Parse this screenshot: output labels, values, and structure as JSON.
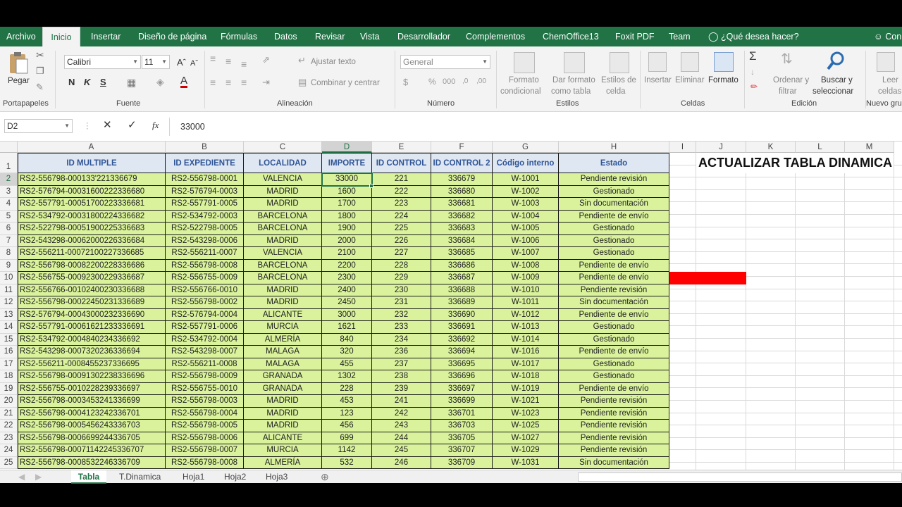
{
  "ribbon_tabs": [
    "Archivo",
    "Inicio",
    "Insertar",
    "Diseño de página",
    "Fórmulas",
    "Datos",
    "Revisar",
    "Vista",
    "Desarrollador",
    "Complementos",
    "ChemOffice13",
    "Foxit PDF",
    "Team",
    "¿Qué desea hacer?",
    "Con"
  ],
  "ribbon": {
    "paste": "Pegar",
    "font_name": "Calibri",
    "font_size": "11",
    "bold": "N",
    "italic": "K",
    "underline": "S",
    "wrap_text": "Ajustar texto",
    "merge_center": "Combinar y centrar",
    "number_format": "General",
    "cond_format_1": "Formato",
    "cond_format_2": "condicional",
    "format_table_1": "Dar formato",
    "format_table_2": "como tabla",
    "cell_styles_1": "Estilos de",
    "cell_styles_2": "celda",
    "insert": "Insertar",
    "delete": "Eliminar",
    "format": "Formato",
    "sort_1": "Ordenar y",
    "sort_2": "filtrar",
    "find_1": "Buscar y",
    "find_2": "seleccionar",
    "read_1": "Leer",
    "read_2": "celdas",
    "groups": [
      "Portapapeles",
      "Fuente",
      "Alineación",
      "Número",
      "Estilos",
      "Celdas",
      "Edición",
      "Nuevo gru"
    ]
  },
  "formula_bar": {
    "name_box": "D2",
    "value": "33000"
  },
  "column_letters": [
    "A",
    "B",
    "C",
    "D",
    "E",
    "F",
    "G",
    "H",
    "I",
    "J",
    "K",
    "L",
    "M"
  ],
  "headers": [
    "ID MULTIPLE",
    "ID EXPEDIENTE",
    "LOCALIDAD",
    "IMPORTE",
    "ID CONTROL",
    "ID CONTROL 2",
    "Código interno",
    "Estado"
  ],
  "side_title": "ACTUALIZAR TABLA DINAMICA",
  "rows": [
    [
      "RS2-556798-000133'221336679",
      "RS2-556798-0001",
      "VALENCIA",
      "33000",
      "221",
      "336679",
      "W-1001",
      "Pendiente revisión"
    ],
    [
      "RS2-576794-00031600222336680",
      "RS2-576794-0003",
      "MADRID",
      "1600",
      "222",
      "336680",
      "W-1002",
      "Gestionado"
    ],
    [
      "RS2-557791-00051700223336681",
      "RS2-557791-0005",
      "MADRID",
      "1700",
      "223",
      "336681",
      "W-1003",
      "Sin documentación"
    ],
    [
      "RS2-534792-00031800224336682",
      "RS2-534792-0003",
      "BARCELONA",
      "1800",
      "224",
      "336682",
      "W-1004",
      "Pendiente de envío"
    ],
    [
      "RS2-522798-00051900225336683",
      "RS2-522798-0005",
      "BARCELONA",
      "1900",
      "225",
      "336683",
      "W-1005",
      "Gestionado"
    ],
    [
      "RS2-543298-00062000226336684",
      "RS2-543298-0006",
      "MADRID",
      "2000",
      "226",
      "336684",
      "W-1006",
      "Gestionado"
    ],
    [
      "RS2-556211-00072100227336685",
      "RS2-556211-0007",
      "VALENCIA",
      "2100",
      "227",
      "336685",
      "W-1007",
      "Gestionado"
    ],
    [
      "RS2-556798-00082200228336686",
      "RS2-556798-0008",
      "BARCELONA",
      "2200",
      "228",
      "336686",
      "W-1008",
      "Pendiente de envío"
    ],
    [
      "RS2-556755-00092300229336687",
      "RS2-556755-0009",
      "BARCELONA",
      "2300",
      "229",
      "336687",
      "W-1009",
      "Pendiente de envío"
    ],
    [
      "RS2-556766-00102400230336688",
      "RS2-556766-0010",
      "MADRID",
      "2400",
      "230",
      "336688",
      "W-1010",
      "Pendiente revisión"
    ],
    [
      "RS2-556798-00022450231336689",
      "RS2-556798-0002",
      "MADRID",
      "2450",
      "231",
      "336689",
      "W-1011",
      "Sin documentación"
    ],
    [
      "RS2-576794-00043000232336690",
      "RS2-576794-0004",
      "ALICANTE",
      "3000",
      "232",
      "336690",
      "W-1012",
      "Pendiente de envío"
    ],
    [
      "RS2-557791-00061621233336691",
      "RS2-557791-0006",
      "MURCIA",
      "1621",
      "233",
      "336691",
      "W-1013",
      "Gestionado"
    ],
    [
      "RS2-534792-0004840234336692",
      "RS2-534792-0004",
      "ALMERÍA",
      "840",
      "234",
      "336692",
      "W-1014",
      "Gestionado"
    ],
    [
      "RS2-543298-0007320236336694",
      "RS2-543298-0007",
      "MALAGA",
      "320",
      "236",
      "336694",
      "W-1016",
      "Pendiente de envío"
    ],
    [
      "RS2-556211-0008455237336695",
      "RS2-556211-0008",
      "MALAGA",
      "455",
      "237",
      "336695",
      "W-1017",
      "Gestionado"
    ],
    [
      "RS2-556798-00091302238336696",
      "RS2-556798-0009",
      "GRANADA",
      "1302",
      "238",
      "336696",
      "W-1018",
      "Gestionado"
    ],
    [
      "RS2-556755-0010228239336697",
      "RS2-556755-0010",
      "GRANADA",
      "228",
      "239",
      "336697",
      "W-1019",
      "Pendiente de envío"
    ],
    [
      "RS2-556798-0003453241336699",
      "RS2-556798-0003",
      "MADRID",
      "453",
      "241",
      "336699",
      "W-1021",
      "Pendiente revisión"
    ],
    [
      "RS2-556798-0004123242336701",
      "RS2-556798-0004",
      "MADRID",
      "123",
      "242",
      "336701",
      "W-1023",
      "Pendiente revisión"
    ],
    [
      "RS2-556798-0005456243336703",
      "RS2-556798-0005",
      "MADRID",
      "456",
      "243",
      "336703",
      "W-1025",
      "Pendiente revisión"
    ],
    [
      "RS2-556798-0006699244336705",
      "RS2-556798-0006",
      "ALICANTE",
      "699",
      "244",
      "336705",
      "W-1027",
      "Pendiente revisión"
    ],
    [
      "RS2-556798-00071142245336707",
      "RS2-556798-0007",
      "MURCIA",
      "1142",
      "245",
      "336707",
      "W-1029",
      "Pendiente revisión"
    ],
    [
      "RS2-556798-0008532246336709",
      "RS2-556798-0008",
      "ALMERÍA",
      "532",
      "246",
      "336709",
      "W-1031",
      "Sin documentación"
    ]
  ],
  "sheet_tabs": [
    "Tabla",
    "T.Dinamica",
    "Hoja1",
    "Hoja2",
    "Hoja3"
  ],
  "colors": {
    "excel_green": "#217346",
    "table_fill": "#d9f29b",
    "header_fill": "#dfe7f3",
    "header_text": "#2f5596",
    "highlight": "#ff0000"
  }
}
